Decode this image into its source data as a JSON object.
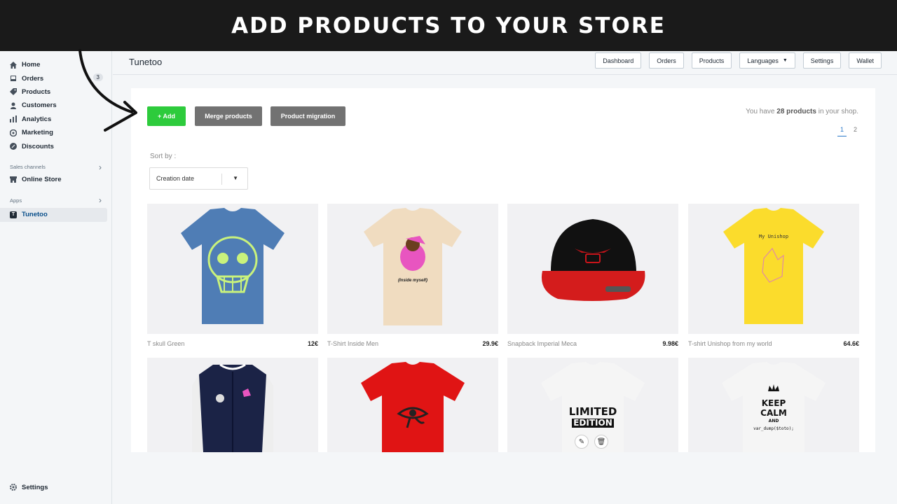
{
  "banner": {
    "title": "ADD PRODUCTS TO YOUR STORE"
  },
  "sidebar": {
    "items": [
      {
        "label": "Home",
        "icon": "home-icon"
      },
      {
        "label": "Orders",
        "icon": "orders-icon",
        "badge": "3"
      },
      {
        "label": "Products",
        "icon": "tag-icon"
      },
      {
        "label": "Customers",
        "icon": "person-icon"
      },
      {
        "label": "Analytics",
        "icon": "bar-chart-icon"
      },
      {
        "label": "Marketing",
        "icon": "target-icon"
      },
      {
        "label": "Discounts",
        "icon": "discount-icon"
      }
    ],
    "sales_channels_title": "Sales channels",
    "online_store": "Online Store",
    "apps_title": "Apps",
    "app_name": "Tunetoo",
    "app_icon_letter": "T",
    "settings": "Settings"
  },
  "topbar": {
    "app_title": "Tunetoo",
    "tabs": [
      "Dashboard",
      "Orders",
      "Products",
      "Languages",
      "Settings",
      "Wallet"
    ]
  },
  "toolbar": {
    "add_label": "+ Add",
    "merge_label": "Merge products",
    "migration_label": "Product migration"
  },
  "summary": {
    "prefix": "You have",
    "count": "28 products",
    "suffix": "in your shop."
  },
  "pagination": {
    "pages": [
      "1",
      "2"
    ],
    "current": "1"
  },
  "sort": {
    "label": "Sort by :",
    "value": "Creation date"
  },
  "products": [
    {
      "name": "T skull Green",
      "price": "12€"
    },
    {
      "name": "T-Shirt Inside Men",
      "price": "29.9€"
    },
    {
      "name": "Snapback Imperial Meca",
      "price": "9.98€"
    },
    {
      "name": "T-shirt Unishop from my world",
      "price": "64.6€"
    },
    {
      "name": "",
      "price": ""
    },
    {
      "name": "",
      "price": ""
    },
    {
      "name": "",
      "price": ""
    },
    {
      "name": "",
      "price": ""
    }
  ],
  "product_art": {
    "inside_text": "(Inside myself)",
    "unishop_text": "My Unishop",
    "limited_line1": "LIMITED",
    "limited_line2": "EDITION",
    "keep_line1": "KEEP",
    "keep_line2": "CALM",
    "keep_line3": "AND",
    "keep_line4": "var_dump($toto);"
  },
  "colors": {
    "banner_bg": "#1a1a1a",
    "add_green": "#2dcb3c",
    "gray_button": "#727272",
    "active_blue": "#2a78c8"
  }
}
